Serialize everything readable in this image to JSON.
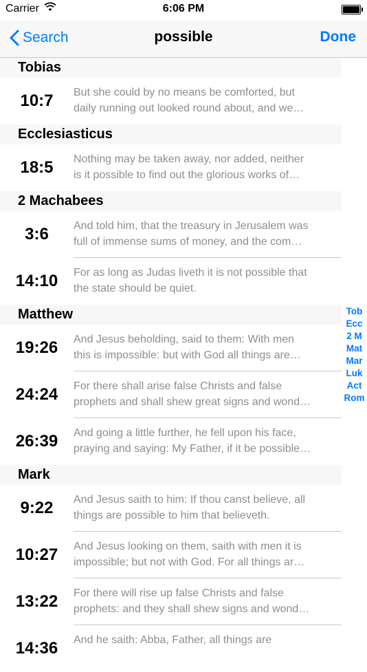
{
  "status": {
    "carrier": "Carrier",
    "time": "6:06 PM"
  },
  "nav": {
    "back_label": "Search",
    "title": "possible",
    "done_label": "Done"
  },
  "sections": [
    {
      "name": "Tobias",
      "rows": [
        {
          "ref": "10:7",
          "line1": "But she could by no means be comforted, but",
          "line2": "daily running out looked round about, and we…"
        }
      ]
    },
    {
      "name": "Ecclesiasticus",
      "rows": [
        {
          "ref": "18:5",
          "line1": "Nothing may be taken away, nor added, neither",
          "line2": "is it possible to find out the glorious works of…"
        }
      ]
    },
    {
      "name": "2 Machabees",
      "rows": [
        {
          "ref": "3:6",
          "line1": "And told him, that the treasury in Jerusalem was",
          "line2": "full of immense sums of money, and the com…"
        },
        {
          "ref": "14:10",
          "line1": "For as long as Judas liveth it is not possible that",
          "line2": "the state should be quiet."
        }
      ]
    },
    {
      "name": "Matthew",
      "rows": [
        {
          "ref": "19:26",
          "line1": "And Jesus beholding, said to them: With men",
          "line2": "this is impossible: but with God all things are…"
        },
        {
          "ref": "24:24",
          "line1": "For there shall arise false Christs and false",
          "line2": "prophets and shall shew great signs and wond…"
        },
        {
          "ref": "26:39",
          "line1": "And going a little further, he fell upon his face,",
          "line2": "praying and saying: My Father, if it be possible…"
        }
      ]
    },
    {
      "name": "Mark",
      "rows": [
        {
          "ref": "9:22",
          "line1": "And Jesus saith to him: If thou canst believe, all",
          "line2": "things are possible to him that believeth."
        },
        {
          "ref": "10:27",
          "line1": "And Jesus looking on them, saith with men it is",
          "line2": "impossible; but not with God. For all things ar…"
        },
        {
          "ref": "13:22",
          "line1": "For there will rise up false Christs and false",
          "line2": "prophets: and they shall shew signs and wond…"
        },
        {
          "ref": "14:36",
          "line1": "And he saith: Abba, Father, all things are",
          "line2": ""
        }
      ]
    }
  ],
  "index": [
    "Tob",
    "Ecc",
    "2 M",
    "Mat",
    "Mar",
    "Luk",
    "Act",
    "Rom"
  ],
  "colors": {
    "accent": "#007aff",
    "snippet": "#8e8e93",
    "header_bg": "#f7f7f7"
  }
}
